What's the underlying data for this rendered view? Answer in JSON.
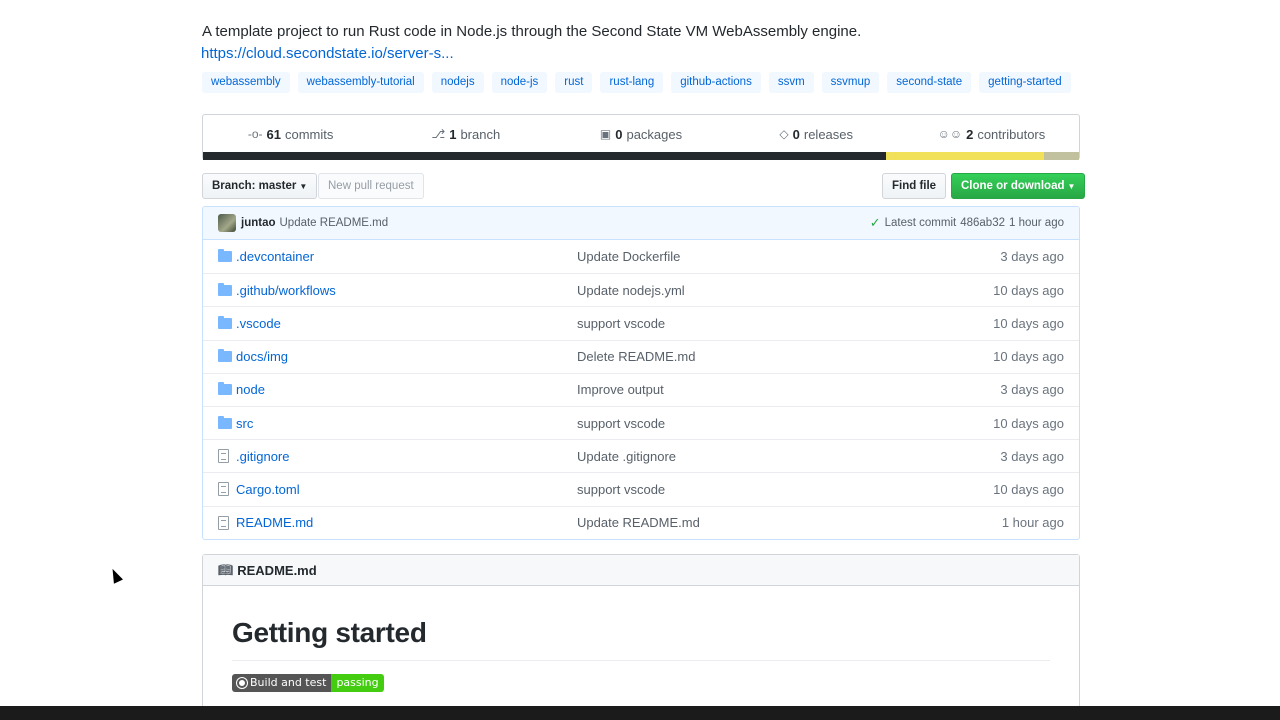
{
  "repo": {
    "description": "A template project to run Rust code in Node.js through the Second State VM WebAssembly engine.",
    "homepage": "https://cloud.secondstate.io/server-s..."
  },
  "topics": [
    "webassembly",
    "webassembly-tutorial",
    "nodejs",
    "node-js",
    "rust",
    "rust-lang",
    "github-actions",
    "ssvm",
    "ssvmup",
    "second-state",
    "getting-started"
  ],
  "summary": {
    "commits_count": "61",
    "commits_label": "commits",
    "branches_count": "1",
    "branches_label": "branch",
    "packages_count": "0",
    "packages_label": "packages",
    "releases_count": "0",
    "releases_label": "releases",
    "contributors_count": "2",
    "contributors_label": "contributors"
  },
  "language_bar": [
    {
      "color": "#24292e",
      "percent": 78.0
    },
    {
      "color": "#f1e05a",
      "percent": 18.0
    },
    {
      "color": "#c1c1a0",
      "percent": 4.0
    }
  ],
  "toolbar": {
    "branch_label": "Branch: master",
    "new_pr_label": "New pull request",
    "find_file_label": "Find file",
    "clone_label": "Clone or download"
  },
  "latest_commit": {
    "author": "juntao",
    "message": "Update README.md",
    "prefix": "Latest commit",
    "sha": "486ab32",
    "age": "1 hour ago"
  },
  "files": [
    {
      "type": "dir",
      "name": ".devcontainer",
      "message": "Update Dockerfile",
      "age": "3 days ago"
    },
    {
      "type": "dir",
      "name": ".github/workflows",
      "message": "Update nodejs.yml",
      "age": "10 days ago"
    },
    {
      "type": "dir",
      "name": ".vscode",
      "message": "support vscode",
      "age": "10 days ago"
    },
    {
      "type": "dir",
      "name": "docs/img",
      "message": "Delete README.md",
      "age": "10 days ago"
    },
    {
      "type": "dir",
      "name": "node",
      "message": "Improve output",
      "age": "3 days ago"
    },
    {
      "type": "dir",
      "name": "src",
      "message": "support vscode",
      "age": "10 days ago"
    },
    {
      "type": "file",
      "name": ".gitignore",
      "message": "Update .gitignore",
      "age": "3 days ago"
    },
    {
      "type": "file",
      "name": "Cargo.toml",
      "message": "support vscode",
      "age": "10 days ago"
    },
    {
      "type": "file",
      "name": "README.md",
      "message": "Update README.md",
      "age": "1 hour ago"
    }
  ],
  "readme": {
    "filename": "README.md",
    "heading": "Getting started",
    "badge_left": "Build and test",
    "badge_right": "passing"
  }
}
